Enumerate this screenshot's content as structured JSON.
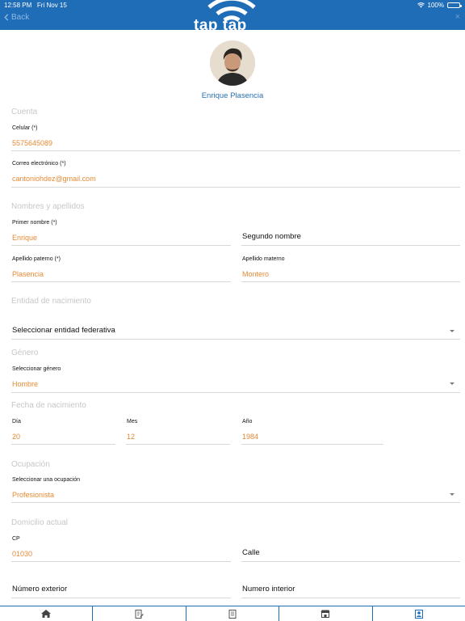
{
  "status": {
    "time": "12:58 PM",
    "date": "Fri Nov 15",
    "battery": "100%"
  },
  "header": {
    "back_label": "Back",
    "logo_text": "tap tap",
    "close_label": "×"
  },
  "profile": {
    "name": "Enrique Plasencia"
  },
  "cuenta": {
    "title": "Cuenta",
    "celular_label": "Celular (*)",
    "celular_value": "5575645089",
    "correo_label": "Correo electrónico (*)",
    "correo_value": "cantoniohdez@gmail.com"
  },
  "nombres": {
    "title": "Nombres y apellidos",
    "primer_label": "Primer nombre (*)",
    "primer_value": "Enrique",
    "segundo_placeholder": "Segundo nombre",
    "paterno_label": "Apellido paterno (*)",
    "paterno_value": "Plasencia",
    "materno_label": "Apellido materno",
    "materno_value": "Montero"
  },
  "nacimiento": {
    "title": "Entidad de nacimiento",
    "select_placeholder": "Seleccionar entidad federativa"
  },
  "genero": {
    "title": "Género",
    "label": "Seleccionar género",
    "value": "Hombre"
  },
  "fecha": {
    "title": "Fecha de nacimiento",
    "dia_label": "Día",
    "dia_value": "20",
    "mes_label": "Mes",
    "mes_value": "12",
    "anio_label": "Año",
    "anio_value": "1984"
  },
  "ocupacion": {
    "title": "Ocupación",
    "label": "Seleccionar una ocupación",
    "value": "Profesionista"
  },
  "domicilio": {
    "title": "Domicilio actual",
    "cp_label": "CP",
    "cp_value": "01030",
    "calle_placeholder": "Calle",
    "exterior_placeholder": "Número exterior",
    "interior_placeholder": "Numero interior"
  },
  "tabs": [
    "home-icon",
    "edit-document-icon",
    "receipt-icon",
    "store-icon",
    "profile-card-icon"
  ],
  "colors": {
    "header": "#1f6db6",
    "accent_value": "#e58a35",
    "name_link": "#2a6fb5"
  }
}
